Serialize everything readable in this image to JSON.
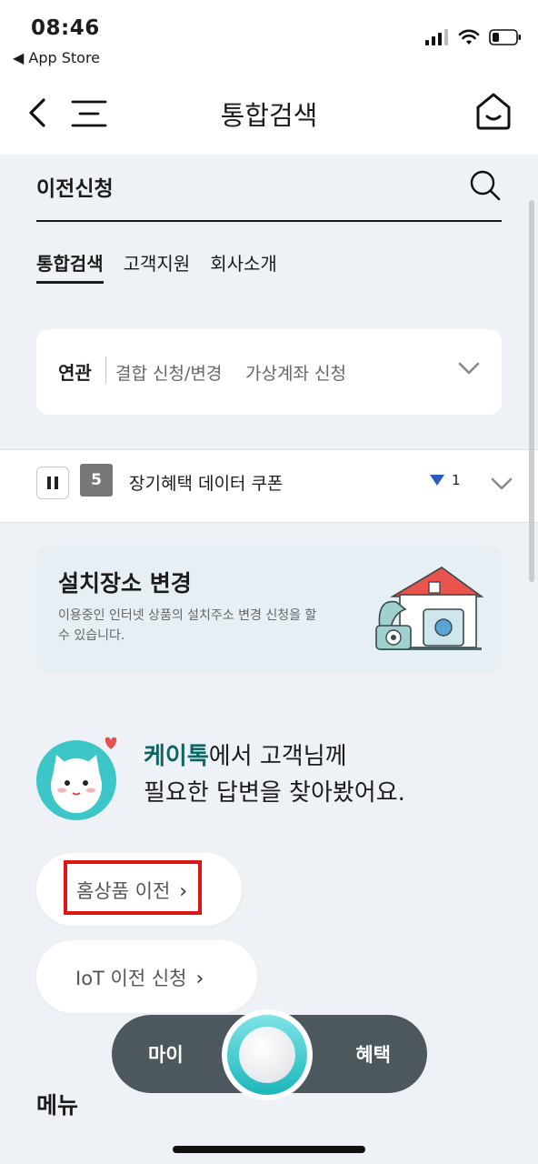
{
  "status_bar": {
    "time": "08:46",
    "back_label": "◀ App Store",
    "icons": [
      "signal-icon",
      "wifi-icon",
      "battery-icon"
    ]
  },
  "nav": {
    "title": "통합검색",
    "icons": [
      "back-icon",
      "menu-icon",
      "home-icon"
    ]
  },
  "search": {
    "query": "이전신청"
  },
  "tabs": [
    {
      "label": "통합검색",
      "active": true
    },
    {
      "label": "고객지원",
      "active": false
    },
    {
      "label": "회사소개",
      "active": false
    }
  ],
  "related": {
    "label": "연관",
    "items": [
      "결합 신청/변경",
      "가상계좌 신청"
    ]
  },
  "ranking": {
    "rank": "5",
    "text": "장기혜택 데이터 쿠폰",
    "change": "1",
    "change_direction": "down",
    "change_color": "#2b5cc4"
  },
  "banner": {
    "title": "설치장소 변경",
    "description": "이용중인 인터넷 상품의 설치주소 변경 신청을 할 수 있습니다."
  },
  "answer": {
    "brand": "케이톡",
    "line1_rest": "에서 고객님께",
    "line2": "필요한 답변을 찾아봤어요.",
    "brand_color": "#0e6466"
  },
  "suggestions": [
    {
      "label": "홈상품 이전",
      "highlighted": true
    },
    {
      "label": "IoT 이전 신청",
      "highlighted": false
    }
  ],
  "menu_label": "메뉴",
  "dock": {
    "left": "마이",
    "right": "혜택",
    "accent": "#1bb6bb"
  }
}
